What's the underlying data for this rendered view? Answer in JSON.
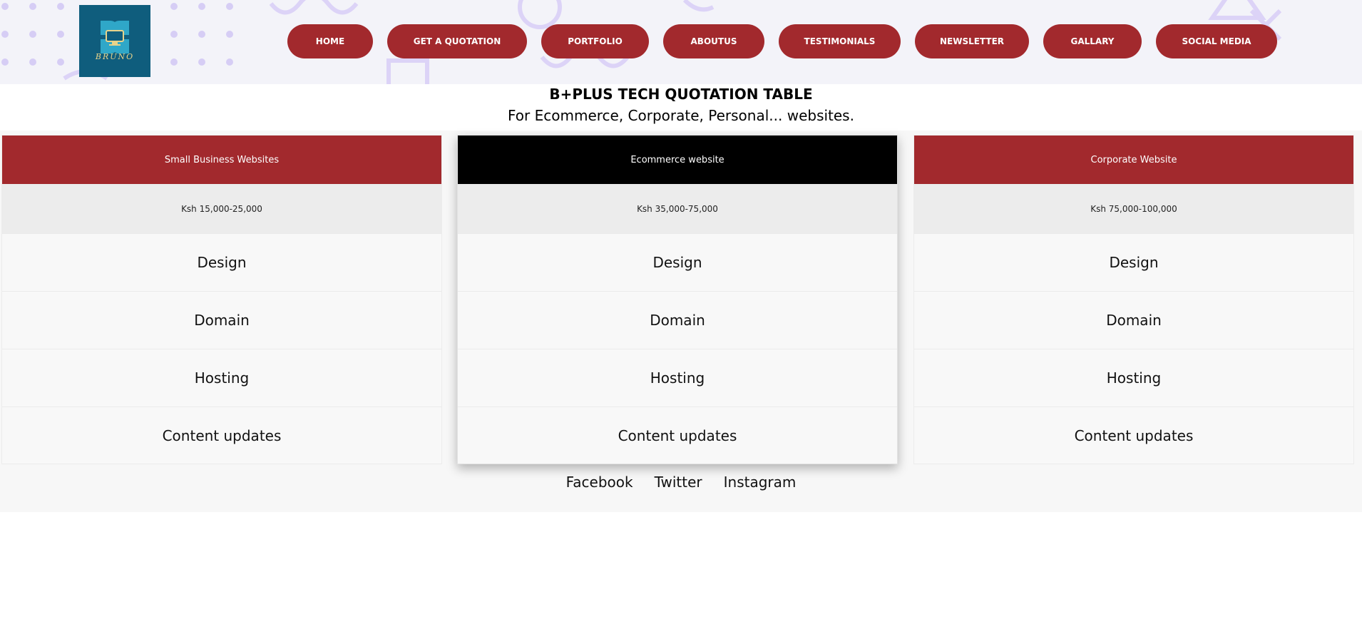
{
  "colors": {
    "brand_red": "#a2292d",
    "featured_black": "#000000",
    "header_bg": "#f3f3f9",
    "logo_bg": "#0f5d7d",
    "decoration": "#d6cdf5"
  },
  "logo": {
    "text": "BRUNO"
  },
  "nav": {
    "items": [
      {
        "label": "HOME"
      },
      {
        "label": "GET A QUOTATION"
      },
      {
        "label": "PORTFOLIO"
      },
      {
        "label": "ABOUTUS"
      },
      {
        "label": "TESTIMONIALS"
      },
      {
        "label": "NEWSLETTER"
      },
      {
        "label": "GALLARY"
      },
      {
        "label": "SOCIAL MEDIA"
      }
    ]
  },
  "heading": {
    "title": "B+PLUS TECH QUOTATION TABLE",
    "subtitle": "For Ecommerce, Corporate, Personal... websites."
  },
  "plans": [
    {
      "name": "Small Business Websites",
      "price": "Ksh 15,000-25,000",
      "features": [
        "Design",
        "Domain",
        "Hosting",
        "Content updates"
      ]
    },
    {
      "name": "Ecommerce website",
      "price": "Ksh 35,000-75,000",
      "features": [
        "Design",
        "Domain",
        "Hosting",
        "Content updates"
      ]
    },
    {
      "name": "Corporate Website",
      "price": "Ksh 75,000-100,000",
      "features": [
        "Design",
        "Domain",
        "Hosting",
        "Content updates"
      ]
    }
  ],
  "social": {
    "links": [
      {
        "label": "Facebook"
      },
      {
        "label": "Twitter"
      },
      {
        "label": "Instagram"
      }
    ]
  }
}
